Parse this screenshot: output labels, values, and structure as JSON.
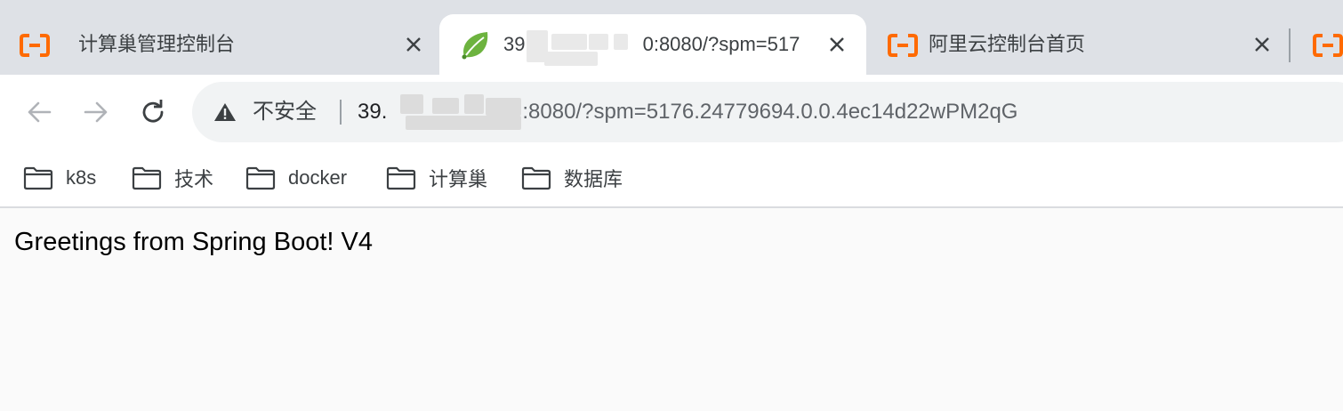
{
  "browser": {
    "tabs": [
      {
        "title": "计算巢管理控制台",
        "icon": "aliyun-logo-icon",
        "active": false
      },
      {
        "title": "39.",
        "title_suffix": "0:8080/?spm=517",
        "icon": "spring-leaf-icon",
        "active": true
      },
      {
        "title": "阿里云控制台首页",
        "icon": "aliyun-logo-icon",
        "active": false
      }
    ],
    "colors": {
      "aliyun_orange": "#ff6a00",
      "spring_green": "#6db33f",
      "tabstrip": "#dee1e6"
    }
  },
  "toolbar": {
    "security_label": "不安全",
    "url_host": "39.",
    "url_rest": ":8080/?spm=5176.24779694.0.0.4ec14d22wPM2qG"
  },
  "bookmarks": [
    {
      "label": "k8s",
      "icon": "folder-icon"
    },
    {
      "label": "技术",
      "icon": "folder-icon"
    },
    {
      "label": "docker",
      "icon": "folder-icon"
    },
    {
      "label": "计算巢",
      "icon": "folder-icon"
    },
    {
      "label": "数据库",
      "icon": "folder-icon"
    }
  ],
  "page": {
    "body_text": "Greetings from Spring Boot! V4"
  }
}
